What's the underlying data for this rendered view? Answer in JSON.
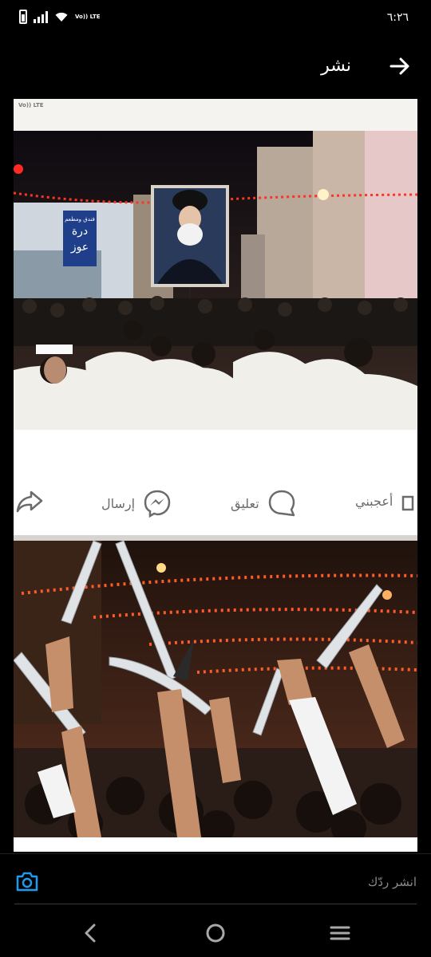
{
  "status_bar": {
    "time": "٦:٢٦",
    "network_label": "Vo)) LTE",
    "icons": [
      "battery-icon",
      "signal-icon",
      "wifi-icon"
    ]
  },
  "top_bar": {
    "title": "نشر",
    "back_icon": "arrow-right-icon"
  },
  "screenshot": {
    "status_label": "Vo)) LTE",
    "photo1": {
      "banner_sign_line1": "فندق ومطعم",
      "banner_sign_line2": "درة",
      "banner_sign_line3": "عوز"
    },
    "actions": {
      "like_label": "أعجبني",
      "comment_label": "تعليق",
      "send_label": "إرسال",
      "share_icon": "share-arrow-icon",
      "send_icon": "messenger-icon",
      "comment_icon": "comment-bubble-icon",
      "like_icon": "thumbs-up-icon"
    }
  },
  "reply_bar": {
    "placeholder": "انشر ردّك",
    "camera_icon": "camera-icon"
  },
  "nav_bar": {
    "icons": [
      "back-chevron-icon",
      "home-circle-icon",
      "recents-menu-icon"
    ]
  },
  "colors": {
    "background": "#000000",
    "accent_blue": "#1d9bf0",
    "action_gray": "#6b6b6b"
  }
}
